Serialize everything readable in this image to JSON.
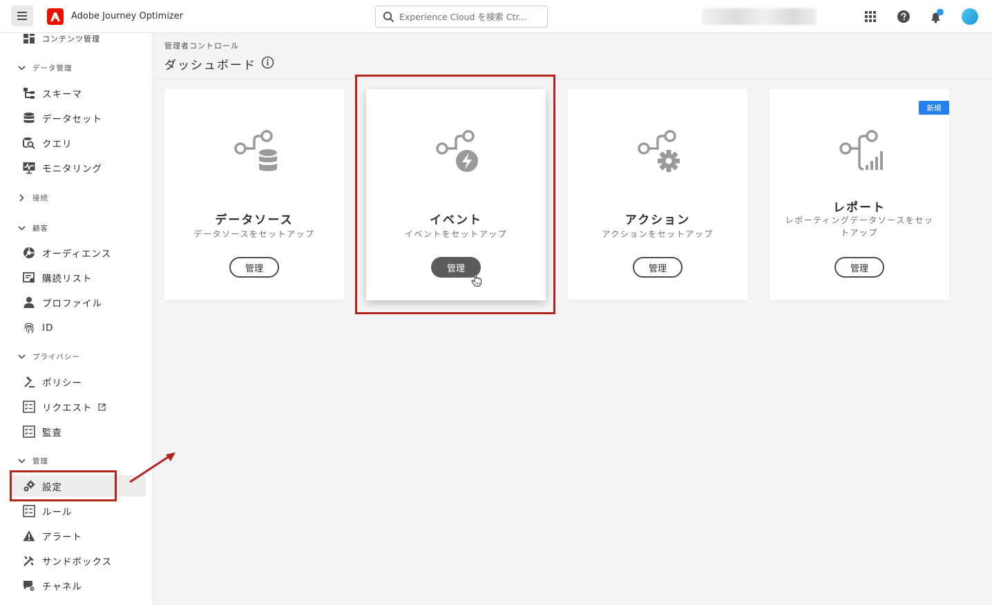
{
  "topbar": {
    "app_name": "Adobe Journey Optimizer",
    "search_placeholder": "Experience Cloud を検索 Ctr..."
  },
  "sidebar": {
    "items": [
      {
        "label": "コンテンツ管理",
        "type": "item",
        "icon": "content-icon"
      },
      {
        "label": "データ管理",
        "type": "section",
        "expanded": true
      },
      {
        "label": "スキーマ",
        "type": "item",
        "icon": "schema-icon"
      },
      {
        "label": "データセット",
        "type": "item",
        "icon": "database-icon"
      },
      {
        "label": "クエリ",
        "type": "item",
        "icon": "query-icon"
      },
      {
        "label": "モニタリング",
        "type": "item",
        "icon": "monitoring-icon"
      },
      {
        "label": "接続",
        "type": "section",
        "expanded": false
      },
      {
        "label": "顧客",
        "type": "section",
        "expanded": true
      },
      {
        "label": "オーディエンス",
        "type": "item",
        "icon": "audience-icon"
      },
      {
        "label": "購読リスト",
        "type": "item",
        "icon": "subscription-icon"
      },
      {
        "label": "プロファイル",
        "type": "item",
        "icon": "profile-icon"
      },
      {
        "label": "ID",
        "type": "item",
        "icon": "fingerprint-icon"
      },
      {
        "label": "プライバシー",
        "type": "section",
        "expanded": true
      },
      {
        "label": "ポリシー",
        "type": "item",
        "icon": "policy-icon"
      },
      {
        "label": "リクエスト",
        "type": "item",
        "icon": "request-icon",
        "external": true
      },
      {
        "label": "監査",
        "type": "item",
        "icon": "audit-icon"
      },
      {
        "label": "管理",
        "type": "section",
        "expanded": true
      },
      {
        "label": "設定",
        "type": "item",
        "icon": "settings-icon",
        "selected": true
      },
      {
        "label": "ルール",
        "type": "item",
        "icon": "rules-icon"
      },
      {
        "label": "アラート",
        "type": "item",
        "icon": "alert-icon"
      },
      {
        "label": "サンドボックス",
        "type": "item",
        "icon": "sandbox-icon"
      },
      {
        "label": "チャネル",
        "type": "item",
        "icon": "channel-icon"
      }
    ]
  },
  "main": {
    "breadcrumb": "管理者コントロール",
    "title": "ダッシュボード",
    "cards": [
      {
        "title": "データソース",
        "subtitle": "データソースをセットアップ",
        "button": "管理",
        "icon": "datasource-icon"
      },
      {
        "title": "イベント",
        "subtitle": "イベントをセットアップ",
        "button": "管理",
        "icon": "event-icon",
        "active": true
      },
      {
        "title": "アクション",
        "subtitle": "アクションをセットアップ",
        "button": "管理",
        "icon": "action-icon"
      },
      {
        "title": "レポート",
        "subtitle": "レポーティングデータソースをセットアップ",
        "button": "管理",
        "icon": "report-icon",
        "badge": "新規"
      }
    ]
  },
  "colors": {
    "highlight": "#b1251d",
    "badge": "#2680eb",
    "brand": "#eb1000"
  }
}
